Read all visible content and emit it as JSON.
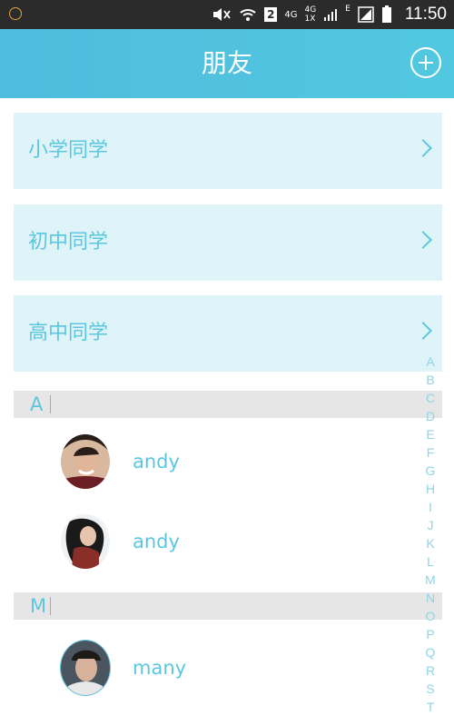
{
  "status_bar": {
    "time": "11:50",
    "sim_badge": "2",
    "network_4g_a": "4G",
    "network_4g_b": "4G",
    "network_1x": "1X",
    "network_e": "E"
  },
  "header": {
    "title": "朋友"
  },
  "groups": [
    {
      "label": "小学同学"
    },
    {
      "label": "初中同学"
    },
    {
      "label": "高中同学"
    }
  ],
  "sections": [
    {
      "letter": "A",
      "contacts": [
        {
          "name": "andy"
        },
        {
          "name": "andy"
        }
      ]
    },
    {
      "letter": "M",
      "contacts": [
        {
          "name": "many"
        }
      ]
    }
  ],
  "alphabet_index": [
    "A",
    "B",
    "C",
    "D",
    "E",
    "F",
    "G",
    "H",
    "I",
    "J",
    "K",
    "L",
    "M",
    "N",
    "O",
    "P",
    "Q",
    "R",
    "S",
    "T"
  ],
  "colors": {
    "accent": "#5cc6e0",
    "header": "#4ebcdd",
    "card_bg": "#def4f8",
    "section_bg": "#e6e6e6"
  }
}
